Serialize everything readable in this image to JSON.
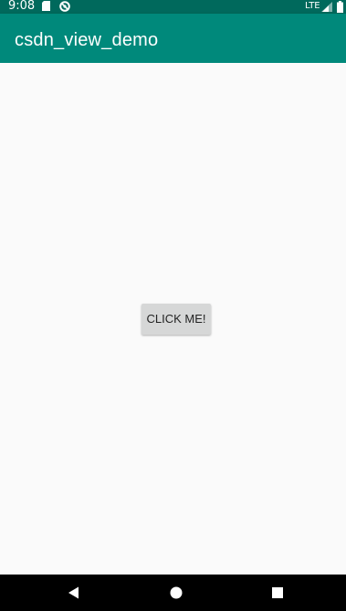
{
  "status_bar": {
    "time": "9:08",
    "network": "LTE",
    "background_color": "#00695c"
  },
  "app_bar": {
    "title": "csdn_view_demo",
    "background_color": "#00897b"
  },
  "main": {
    "button_label": "CLICK ME!"
  },
  "nav_bar": {
    "icons": [
      "back-icon",
      "home-icon",
      "recents-icon"
    ]
  }
}
